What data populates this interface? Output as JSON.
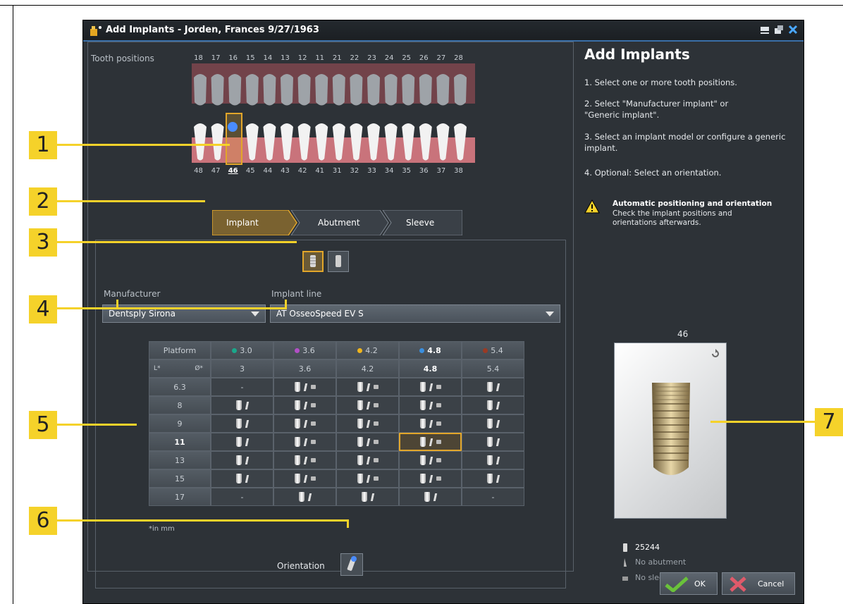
{
  "window": {
    "title": "Add Implants - Jorden, Frances 9/27/1963"
  },
  "teeth": {
    "label": "Tooth positions",
    "upper": [
      "18",
      "17",
      "16",
      "15",
      "14",
      "13",
      "12",
      "11",
      "21",
      "22",
      "23",
      "24",
      "25",
      "26",
      "27",
      "28"
    ],
    "lower": [
      "48",
      "47",
      "46",
      "45",
      "44",
      "43",
      "42",
      "41",
      "31",
      "32",
      "33",
      "34",
      "35",
      "36",
      "37",
      "38"
    ],
    "selected": "46"
  },
  "tabs": [
    "Implant",
    "Abutment",
    "Sleeve"
  ],
  "manufacturer": {
    "label": "Manufacturer",
    "value": "Dentsply Sirona"
  },
  "implant_line": {
    "label": "Implant line",
    "value": "AT OsseoSpeed EV S"
  },
  "table": {
    "platform_label": "Platform",
    "length_label": "L*",
    "diameter_label": "Ø*",
    "platforms": [
      {
        "name": "3.0",
        "color": "#1aa88b"
      },
      {
        "name": "3.6",
        "color": "#b24fc6"
      },
      {
        "name": "4.2",
        "color": "#f0b51c"
      },
      {
        "name": "4.8",
        "color": "#3a8fe0"
      },
      {
        "name": "5.4",
        "color": "#9a3a24"
      }
    ],
    "diameters": [
      "3",
      "3.6",
      "4.2",
      "4.8",
      "5.4"
    ],
    "lengths": [
      "6.3",
      "8",
      "9",
      "11",
      "13",
      "15",
      "17"
    ],
    "selected_length": "11",
    "selected_diameter": "4.8",
    "footnote": "*in mm",
    "cells": [
      [
        "-",
        "ias",
        "ias",
        "ias",
        "ia"
      ],
      [
        "ia",
        "ias",
        "ias",
        "ias",
        "ia"
      ],
      [
        "ia",
        "ias",
        "ias",
        "ias",
        "ia"
      ],
      [
        "ia",
        "ias",
        "ias",
        "ias",
        "ia"
      ],
      [
        "ia",
        "ias",
        "ias",
        "ias",
        "ia"
      ],
      [
        "ia",
        "ias",
        "ias",
        "ias",
        "ia"
      ],
      [
        "-",
        "ia",
        "ia",
        "ia",
        "-"
      ]
    ]
  },
  "orientation_label": "Orientation",
  "right": {
    "title": "Add Implants",
    "steps": [
      "1. Select one or more tooth positions.",
      "2. Select \"Manufacturer implant\" or \"Generic implant\".",
      "3. Select an implant model or configure a generic implant.",
      "4. Optional: Select an orientation."
    ],
    "warning_title": "Automatic positioning and orientation",
    "warning_text": "Check the implant positions and orientations afterwards.",
    "preview_tooth": "46",
    "implant_id": "25244",
    "abutment_text": "No abutment",
    "sleeve_text": "No sleeve",
    "ok_label": "OK",
    "cancel_label": "Cancel"
  },
  "callouts": [
    "1",
    "2",
    "3",
    "4",
    "5",
    "6",
    "7"
  ]
}
